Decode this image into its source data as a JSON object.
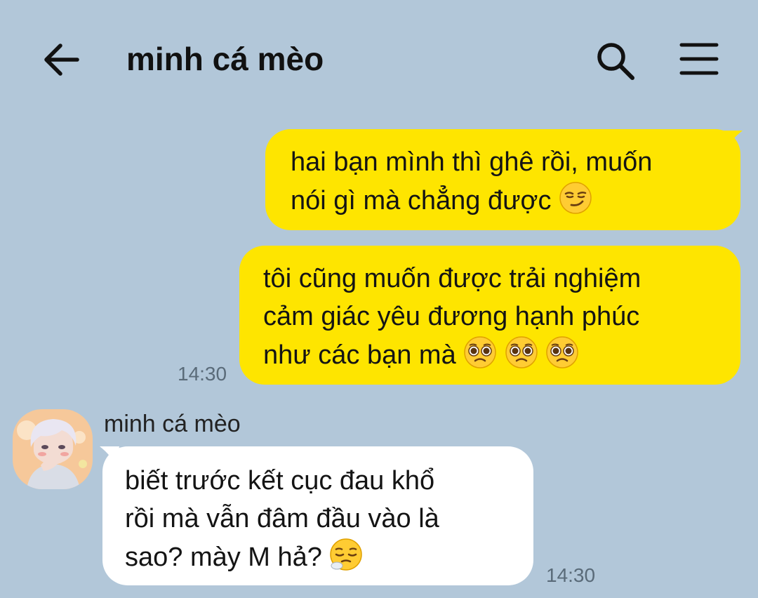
{
  "header": {
    "title": "minh cá mèo",
    "back_icon": "arrow-left-icon",
    "search_icon": "search-icon",
    "menu_icon": "menu-icon"
  },
  "messages": [
    {
      "sender": "me",
      "lines": [
        "hai bạn mình thì ghê rồi, muốn",
        "nói gì mà chẳng được"
      ],
      "emojis": [
        "smirk-emoji"
      ]
    },
    {
      "sender": "me",
      "lines": [
        "tôi cũng muốn được trải nghiệm",
        "cảm giác yêu đương hạnh phúc",
        "như các bạn mà"
      ],
      "emojis": [
        "pleading-face-emoji",
        "pleading-face-emoji",
        "pleading-face-emoji"
      ],
      "time": "14:30"
    },
    {
      "sender": "other",
      "name": "minh cá mèo",
      "lines": [
        "biết trước kết cục đau khổ",
        "rồi mà vẫn đâm đầu vào là",
        "sao? mày M hả?"
      ],
      "emojis": [
        "tired-face-emoji"
      ],
      "time": "14:30"
    }
  ],
  "colors": {
    "background": "#b2c7d9",
    "my_bubble": "#fee500",
    "other_bubble": "#ffffff"
  }
}
